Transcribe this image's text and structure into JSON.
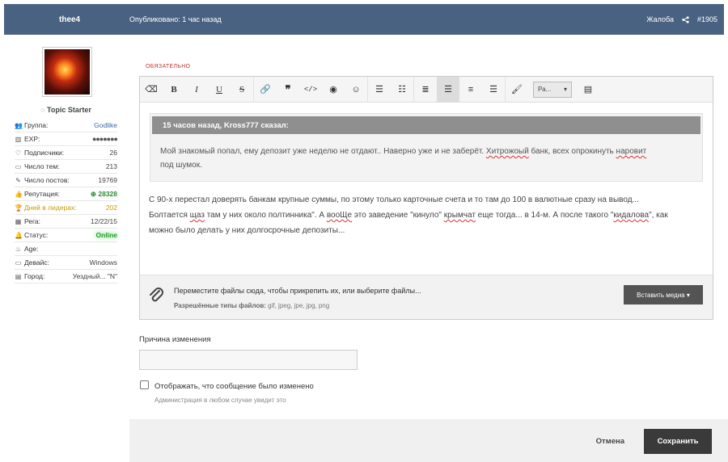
{
  "header": {
    "author": "thee4",
    "published": "Опубликовано: 1 час назад",
    "report": "Жалоба",
    "post_number": "#1905",
    "bg_color": "#4a6282"
  },
  "sidebar": {
    "role": "Topic Starter",
    "stats": [
      {
        "label": "Группа:",
        "value": "Godlike",
        "icon": "users-icon"
      },
      {
        "label": "EXP:",
        "value": "●●●●●●●",
        "icon": "signal-icon"
      },
      {
        "label": "Подписчики:",
        "value": "26",
        "icon": "heart-icon"
      },
      {
        "label": "Число тем:",
        "value": "213",
        "icon": "comments-icon"
      },
      {
        "label": "Число постов:",
        "value": "19769",
        "icon": "edit-icon"
      },
      {
        "label": "Репутация:",
        "value": "28328",
        "icon": "thumbs-up-icon"
      },
      {
        "label": "Дней в лидерах:",
        "value": "202",
        "icon": "trophy-icon"
      },
      {
        "label": "Рега:",
        "value": "12/22/15",
        "icon": "calendar-icon"
      },
      {
        "label": "Статус:",
        "value": "Online",
        "icon": "bell-icon"
      },
      {
        "label": "Age:",
        "value": "",
        "icon": "cake-icon"
      },
      {
        "label": "Девайс:",
        "value": "Windows",
        "icon": "laptop-icon"
      },
      {
        "label": "Город:",
        "value": "Уездный... \"N\"",
        "icon": "id-card-icon"
      }
    ]
  },
  "editor": {
    "required_label": "ОБЯЗАТЕЛЬНО",
    "font_select": "Ра...",
    "quote": {
      "header": "15 часов назад, Kross777 сказал:",
      "line1_a": "Мой знакомый попал, ему депозит уже неделю не отдают.. Наверно уже и не заберёт. ",
      "line1_b": "Хитрожоый",
      "line1_c": " банк, всех опрокинуть ",
      "line1_d": "наровит",
      "line2": "под шумок."
    },
    "post": {
      "line1": "С 90-х перестал доверять банкам крупные суммы, по этому только карточные счета и то там до 100 в валютные сразу на вывод...",
      "line2_a": "Болтается ",
      "line2_b": "щаз",
      "line2_c": " там у них около полтинника\". А ",
      "line2_d": "вооЩе",
      "line2_e": " это заведение \"кинуло\" ",
      "line2_f": "крымчат",
      "line2_g": " еще тогда... в 14-м. А после такого \"",
      "line2_h": "кидалова",
      "line2_i": "\", как",
      "line3": "можно было делать у них долгосрочные депозиты..."
    },
    "attach": {
      "text": "Переместите файлы сюда, чтобы прикрепить их, или выберите файлы...",
      "types_label": "Разрешённые типы файлов:",
      "types": " gif, jpeg, jpe, jpg, png",
      "media_button": "Вставить медиа ▾"
    }
  },
  "form": {
    "reason_label": "Причина изменения",
    "reason_value": "",
    "show_edited_label": "Отображать, что сообщение было изменено",
    "show_edited_note": "Администрация в любом случае увидит это",
    "cancel": "Отмена",
    "save": "Сохранить"
  }
}
